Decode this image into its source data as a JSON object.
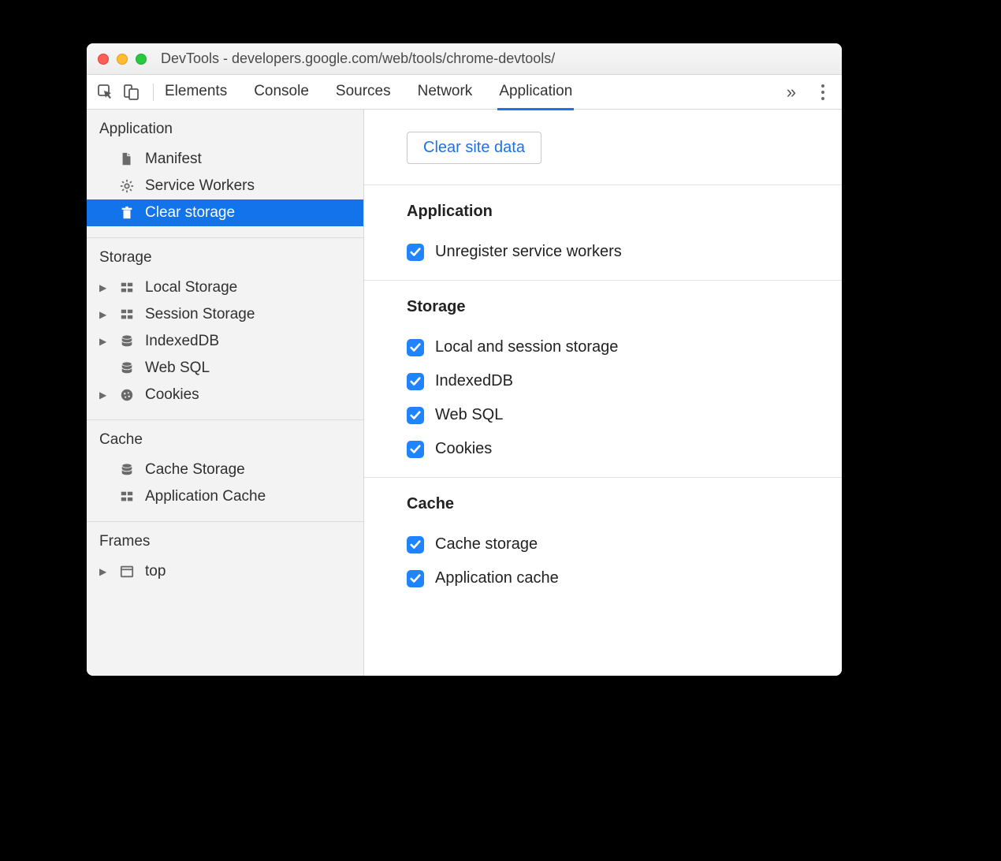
{
  "window": {
    "title": "DevTools - developers.google.com/web/tools/chrome-devtools/"
  },
  "toolbar": {
    "tabs": [
      "Elements",
      "Console",
      "Sources",
      "Network",
      "Application"
    ],
    "active_tab": "Application"
  },
  "sidebar": {
    "sections": [
      {
        "heading": "Application",
        "items": [
          {
            "id": "manifest",
            "label": "Manifest",
            "icon": "file-icon",
            "expandable": false
          },
          {
            "id": "service-workers",
            "label": "Service Workers",
            "icon": "gear-icon",
            "expandable": false
          },
          {
            "id": "clear-storage",
            "label": "Clear storage",
            "icon": "trash-icon",
            "expandable": false,
            "selected": true
          }
        ]
      },
      {
        "heading": "Storage",
        "items": [
          {
            "id": "local-storage",
            "label": "Local Storage",
            "icon": "grid-icon",
            "expandable": true
          },
          {
            "id": "session-storage",
            "label": "Session Storage",
            "icon": "grid-icon",
            "expandable": true
          },
          {
            "id": "indexeddb",
            "label": "IndexedDB",
            "icon": "database-icon",
            "expandable": true
          },
          {
            "id": "web-sql",
            "label": "Web SQL",
            "icon": "database-icon",
            "expandable": false
          },
          {
            "id": "cookies",
            "label": "Cookies",
            "icon": "cookie-icon",
            "expandable": true
          }
        ]
      },
      {
        "heading": "Cache",
        "items": [
          {
            "id": "cache-storage",
            "label": "Cache Storage",
            "icon": "database-icon",
            "expandable": false
          },
          {
            "id": "application-cache",
            "label": "Application Cache",
            "icon": "grid-icon",
            "expandable": false
          }
        ]
      },
      {
        "heading": "Frames",
        "items": [
          {
            "id": "top-frame",
            "label": "top",
            "icon": "frame-icon",
            "expandable": true
          }
        ]
      }
    ]
  },
  "main": {
    "clear_button_label": "Clear site data",
    "groups": [
      {
        "title": "Application",
        "options": [
          {
            "id": "unregister-sw",
            "label": "Unregister service workers",
            "checked": true
          }
        ]
      },
      {
        "title": "Storage",
        "options": [
          {
            "id": "local-session",
            "label": "Local and session storage",
            "checked": true
          },
          {
            "id": "idb",
            "label": "IndexedDB",
            "checked": true
          },
          {
            "id": "websql",
            "label": "Web SQL",
            "checked": true
          },
          {
            "id": "cookies-opt",
            "label": "Cookies",
            "checked": true
          }
        ]
      },
      {
        "title": "Cache",
        "options": [
          {
            "id": "cache-storage-opt",
            "label": "Cache storage",
            "checked": true
          },
          {
            "id": "app-cache-opt",
            "label": "Application cache",
            "checked": true
          }
        ]
      }
    ]
  }
}
